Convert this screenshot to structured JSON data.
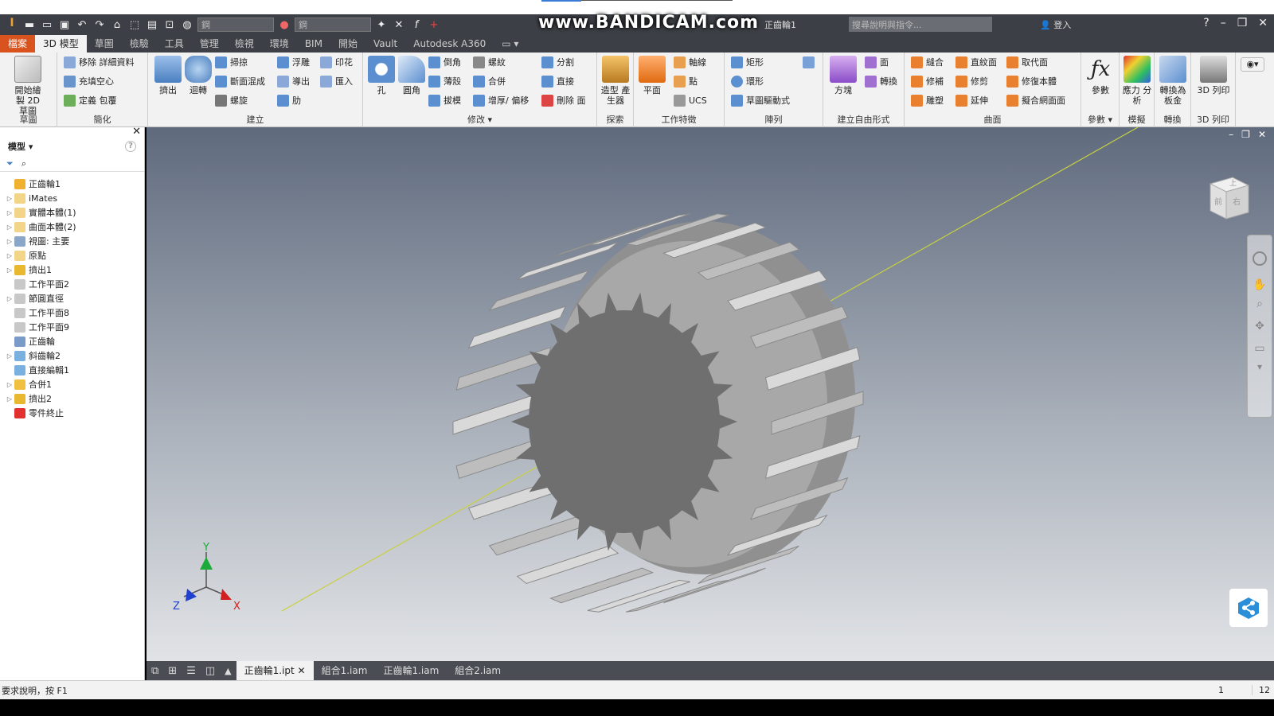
{
  "watermark": "www.BANDICAM.com",
  "titlebar": {
    "doc_title": "正齒輪1",
    "search_placeholder": "搜尋說明與指令...",
    "signin": "登入",
    "material": "鋼",
    "appearance": "鋼"
  },
  "tabs": [
    "檔案",
    "3D 模型",
    "草圖",
    "檢驗",
    "工具",
    "管理",
    "檢視",
    "環境",
    "BIM",
    "開始",
    "Vault",
    "Autodesk A360"
  ],
  "panels": {
    "sketch": {
      "label": "草圖",
      "btn": "開始繪製 2D 草圖"
    },
    "simplify": {
      "label": "簡化",
      "items": [
        "移除 詳細資料",
        "充填空心",
        "定義 包覆"
      ]
    },
    "create": {
      "label": "建立",
      "big": [
        "擠出",
        "迴轉"
      ],
      "items": [
        "掃掠",
        "斷面混成",
        "螺旋",
        "浮雕",
        "導出",
        "肋",
        "印花",
        "匯入"
      ]
    },
    "modify": {
      "label": "修改",
      "big": [
        "孔",
        "圓角"
      ],
      "items": [
        "倒角",
        "薄殼",
        "拔模",
        "螺紋",
        "合併",
        "增厚/ 偏移",
        "分割",
        "直接",
        "刪除 面"
      ]
    },
    "explore": {
      "label": "探索",
      "btn": "造型 產生器"
    },
    "workfeatures": {
      "label": "工作特徵",
      "big": "平面",
      "items": [
        "軸線",
        "點",
        "UCS"
      ]
    },
    "pattern": {
      "label": "陣列",
      "items": [
        "矩形",
        "環形",
        "草圖驅動式"
      ]
    },
    "freeform": {
      "label": "建立自由形式",
      "big": "方塊",
      "items": [
        "面",
        "轉換"
      ]
    },
    "surface": {
      "label": "曲面",
      "items": [
        "縫合",
        "修補",
        "雕塑",
        "直紋面",
        "修剪",
        "延伸",
        "取代面",
        "修復本體",
        "擬合網面面"
      ]
    },
    "params": {
      "label": "參數",
      "btn": "參數"
    },
    "simulation": {
      "label": "模擬",
      "btn": "應力 分析"
    },
    "convert": {
      "label": "轉換",
      "btn": "轉換為 板金"
    },
    "print3d": {
      "label": "3D 列印",
      "btn": "3D 列印"
    }
  },
  "browser": {
    "title": "模型",
    "nodes": [
      {
        "label": "正齒輪1",
        "exp": false,
        "color": "#f0b030"
      },
      {
        "label": "iMates",
        "exp": true,
        "color": "#f3d58a"
      },
      {
        "label": "實體本體(1)",
        "exp": true,
        "color": "#f3d58a"
      },
      {
        "label": "曲面本體(2)",
        "exp": true,
        "color": "#f3d58a"
      },
      {
        "label": "視圖: 主要",
        "exp": true,
        "color": "#8aa6c8"
      },
      {
        "label": "原點",
        "exp": true,
        "color": "#f3d58a"
      },
      {
        "label": "擠出1",
        "exp": true,
        "color": "#e8b830"
      },
      {
        "label": "工作平面2",
        "exp": false,
        "color": "#c8c8c8"
      },
      {
        "label": "節圓直徑",
        "exp": true,
        "color": "#c8c8c8"
      },
      {
        "label": "工作平面8",
        "exp": false,
        "color": "#c8c8c8"
      },
      {
        "label": "工作平面9",
        "exp": false,
        "color": "#c8c8c8"
      },
      {
        "label": "正齒輪",
        "exp": false,
        "color": "#7a9ac8"
      },
      {
        "label": "斜齒輪2",
        "exp": true,
        "color": "#7ab0e0"
      },
      {
        "label": "直接編輯1",
        "exp": false,
        "color": "#7ab0e0"
      },
      {
        "label": "合併1",
        "exp": true,
        "color": "#f0c040"
      },
      {
        "label": "擠出2",
        "exp": true,
        "color": "#e8b830"
      },
      {
        "label": "零件終止",
        "exp": false,
        "color": "#e03030"
      }
    ]
  },
  "doctabs": [
    "正齒輪1.ipt",
    "組合1.iam",
    "正齒輪1.iam",
    "組合2.iam"
  ],
  "status": {
    "help": "要求說明，按 F1",
    "n1": "1",
    "n2": "12"
  },
  "viewcube": {
    "top": "上",
    "front": "前",
    "right": "右"
  },
  "axes": {
    "x": "X",
    "y": "Y",
    "z": "Z"
  }
}
